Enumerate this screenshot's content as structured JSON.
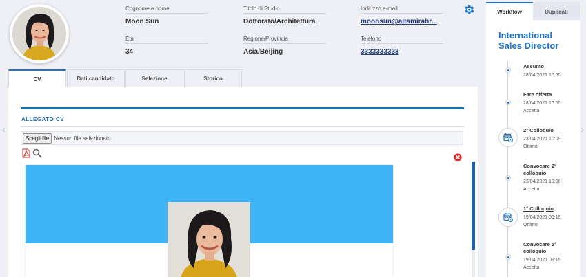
{
  "header": {
    "fields": [
      {
        "label": "Cognome e nome",
        "value": "Moon Sun",
        "link": false
      },
      {
        "label": "Titolo di Studio",
        "value": "Dottorato/Architettura",
        "link": false
      },
      {
        "label": "Indirizzo e-mail",
        "value": "moonsun@altamirahr...",
        "link": true
      },
      {
        "label": "Età",
        "value": "34",
        "link": false
      },
      {
        "label": "Regione/Provincia",
        "value": "Asia/Beijing",
        "link": false
      },
      {
        "label": "Telefono",
        "value": "3333333333",
        "link": true
      }
    ],
    "settings_icon": "gear-icon"
  },
  "tabs": [
    {
      "label": "CV",
      "active": true
    },
    {
      "label": "Dati candidato",
      "active": false
    },
    {
      "label": "Selezione",
      "active": false
    },
    {
      "label": "Storico",
      "active": false
    }
  ],
  "cv": {
    "section_title": "ALLEGATO CV",
    "file_button": "Scegli file",
    "file_status": "Nessun file selezionato",
    "icons": [
      "pdf-icon",
      "zoom-icon",
      "close-icon"
    ],
    "banner_color": "#3fb4f7",
    "scroll_position": 0.76
  },
  "sidebar": {
    "tabs": [
      {
        "label": "Workflow",
        "active": true
      },
      {
        "label": "Duplicati",
        "active": false
      }
    ],
    "job_title": "International Sales Director",
    "timeline": [
      {
        "title": "Assunto",
        "date": "28/04/2021 10:55",
        "status": "",
        "marker": "dot",
        "link": false
      },
      {
        "title": "Fare offerta",
        "date": "28/04/2021 10:55",
        "status": "Accetta",
        "marker": "dot",
        "link": false
      },
      {
        "title": "2° Colloquio",
        "date": "23/04/2021 10:09",
        "status": "Ottimo",
        "marker": "calendar",
        "link": false
      },
      {
        "title": "Convocare 2° colloquio",
        "date": "23/04/2021 10:08",
        "status": "Accetta",
        "marker": "dot",
        "link": false
      },
      {
        "title": "1° Colloquio",
        "date": "19/04/2021 09:15",
        "status": "Ottimo",
        "marker": "calendar",
        "link": true
      },
      {
        "title": "Convocare 1° colloquio",
        "date": "19/04/2021 09:15",
        "status": "Accetta",
        "marker": "dot",
        "link": false
      }
    ]
  },
  "colors": {
    "accent": "#1e75c8",
    "section": "#1e6db5",
    "link": "#1f3d7a"
  }
}
